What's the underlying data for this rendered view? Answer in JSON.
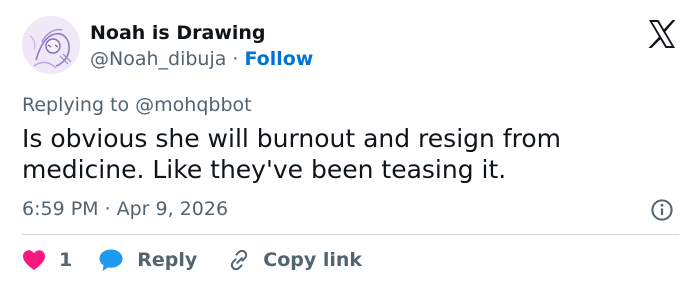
{
  "author": {
    "display_name": "Noah is Drawing",
    "handle": "@Noah_dibuja",
    "separator": "·",
    "follow_label": "Follow"
  },
  "reply_context": {
    "prefix": "Replying to",
    "mention": "@mohqbbot"
  },
  "tweet": {
    "text": "Is obvious she will burnout and resign from medicine. Like they've been teasing it."
  },
  "meta": {
    "time": "6:59 PM",
    "separator": "·",
    "date": "Apr 9, 2026"
  },
  "actions": {
    "like_count": "1",
    "reply_label": "Reply",
    "copy_link_label": "Copy link"
  },
  "colors": {
    "accent": "#0074d4",
    "like": "#f91880",
    "reply_bubble": "#1d9bf0",
    "text_primary": "#0f1419",
    "text_secondary": "#536471",
    "divider": "#cfd9de"
  },
  "icons": {
    "logo": "x-logo-icon",
    "info": "info-icon",
    "like": "heart-icon",
    "reply": "speech-bubble-icon",
    "copy": "link-icon"
  }
}
